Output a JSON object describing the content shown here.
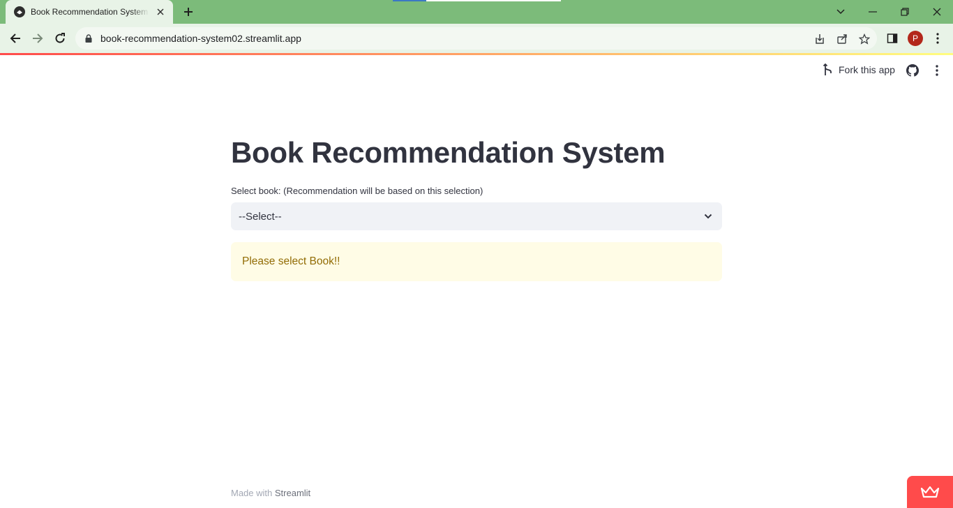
{
  "browser": {
    "tab_title": "Book Recommendation System · Streamlit",
    "url": "book-recommendation-system02.streamlit.app",
    "profile_initial": "P",
    "tab_color": "#e8f3e7",
    "titlebar_color": "#7cbb7a"
  },
  "header": {
    "fork_label": "Fork this app",
    "github_icon": "github-icon",
    "menu_icon": "kebab-menu-icon"
  },
  "main": {
    "title": "Book Recommendation System",
    "select_label": "Select book: (Recommendation will be based on this selection)",
    "select_value": "--Select--",
    "alert_text": "Please select Book!!",
    "alert_color": "#926c05"
  },
  "footer": {
    "prefix": "Made with",
    "brand": "Streamlit"
  },
  "colors": {
    "accent": "#ff4b4b",
    "text": "#31333f"
  }
}
